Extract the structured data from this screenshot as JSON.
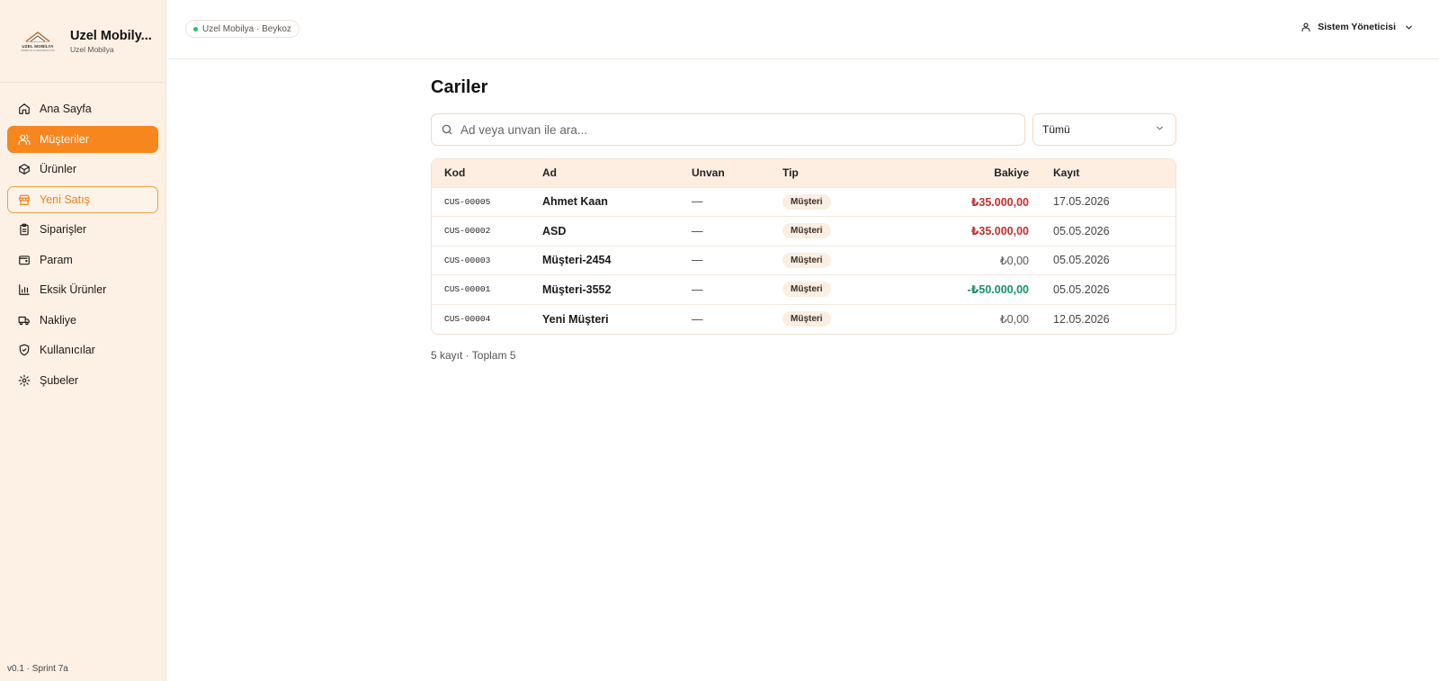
{
  "brand": {
    "logo_text": "UZEL MOBİLYA",
    "logo_sub": "MOBİLYA & DEKORASYON",
    "name": "Uzel Mobilya",
    "name_display": "Uzel Mobily...",
    "subtitle": "Uzel Mobilya"
  },
  "sidebar": {
    "items": [
      {
        "label": "Ana Sayfa",
        "icon": "home-icon"
      },
      {
        "label": "Müşteriler",
        "icon": "users-icon",
        "state": "active"
      },
      {
        "label": "Ürünler",
        "icon": "box-icon"
      },
      {
        "label": "Yeni Satış",
        "icon": "store-icon",
        "state": "outlined"
      },
      {
        "label": "Siparişler",
        "icon": "clipboard-icon"
      },
      {
        "label": "Param",
        "icon": "wallet-icon"
      },
      {
        "label": "Eksik Ürünler",
        "icon": "bar-chart-icon"
      },
      {
        "label": "Nakliye",
        "icon": "truck-icon"
      },
      {
        "label": "Kullanıcılar",
        "icon": "shield-icon"
      },
      {
        "label": "Şubeler",
        "icon": "gear-icon"
      }
    ],
    "version": "v0.1 · Sprint 7a"
  },
  "header": {
    "branch": "Uzel Mobilya · Beykoz",
    "user": "Sistem Yöneticisi"
  },
  "page": {
    "title": "Cariler",
    "search_placeholder": "Ad veya unvan ile ara...",
    "filter_value": "Tümü"
  },
  "table": {
    "columns": {
      "kod": "Kod",
      "ad": "Ad",
      "unvan": "Unvan",
      "tip": "Tip",
      "bakiye": "Bakiye",
      "kayit": "Kayıt"
    },
    "rows": [
      {
        "kod": "CUS-00005",
        "ad": "Ahmet Kaan",
        "unvan": "—",
        "tip": "Müşteri",
        "bakiye": "₺35.000,00",
        "kayit": "17.05.2026"
      },
      {
        "kod": "CUS-00002",
        "ad": "ASD",
        "unvan": "—",
        "tip": "Müşteri",
        "bakiye": "₺35.000,00",
        "kayit": "05.05.2026"
      },
      {
        "kod": "CUS-00003",
        "ad": "Müşteri-2454",
        "unvan": "—",
        "tip": "Müşteri",
        "bakiye": "₺0,00",
        "kayit": "05.05.2026"
      },
      {
        "kod": "CUS-00001",
        "ad": "Müşteri-3552",
        "unvan": "—",
        "tip": "Müşteri",
        "bakiye": "-₺50.000,00",
        "kayit": "05.05.2026"
      },
      {
        "kod": "CUS-00004",
        "ad": "Yeni Müşteri",
        "unvan": "—",
        "tip": "Müşteri",
        "bakiye": "₺0,00",
        "kayit": "12.05.2026"
      }
    ],
    "summary": "5 kayıt · Toplam 5"
  },
  "colors": {
    "accent": "#f7861e",
    "sidebar_bg": "#fdf1e6",
    "negative_balance": "#c22f2f",
    "positive_balance": "#17906b",
    "status_dot": "#22c55e"
  }
}
